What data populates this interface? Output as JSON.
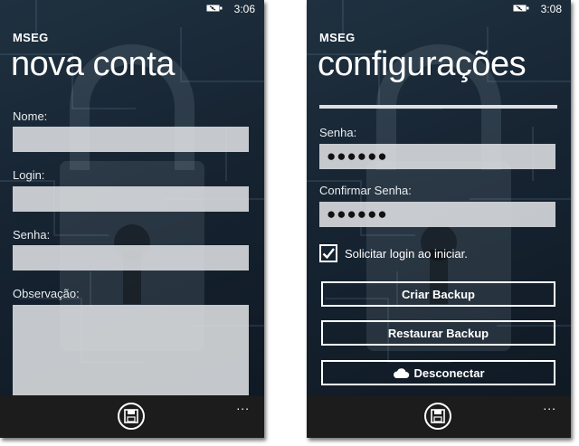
{
  "screens": [
    {
      "status": {
        "time": "3:06"
      },
      "app_name": "MSEG",
      "title": "nova conta",
      "fields": [
        {
          "label": "Nome:",
          "value": ""
        },
        {
          "label": "Login:",
          "value": ""
        },
        {
          "label": "Senha:",
          "value": ""
        },
        {
          "label": "Observação:",
          "value": ""
        }
      ],
      "app_bar": {
        "more": "..."
      }
    },
    {
      "status": {
        "time": "3:08"
      },
      "app_name": "MSEG",
      "title": "configurações",
      "fields": [
        {
          "label": "Senha:",
          "value": "●●●●●●"
        },
        {
          "label": "Confirmar Senha:",
          "value": "●●●●●●"
        }
      ],
      "checkbox": {
        "label": "Solicitar login ao iniciar.",
        "checked": true
      },
      "buttons": [
        {
          "label": "Criar Backup"
        },
        {
          "label": "Restaurar Backup"
        },
        {
          "label": "Desconectar",
          "icon": "cloud-icon"
        }
      ],
      "app_bar": {
        "more": "..."
      }
    }
  ],
  "colors": {
    "background": "#162331",
    "input": "#e2e4e6",
    "app_bar": "#1c1c1c",
    "text": "#ffffff"
  },
  "icons": {
    "battery": "battery-icon",
    "save": "save-icon",
    "cloud": "cloud-icon"
  }
}
